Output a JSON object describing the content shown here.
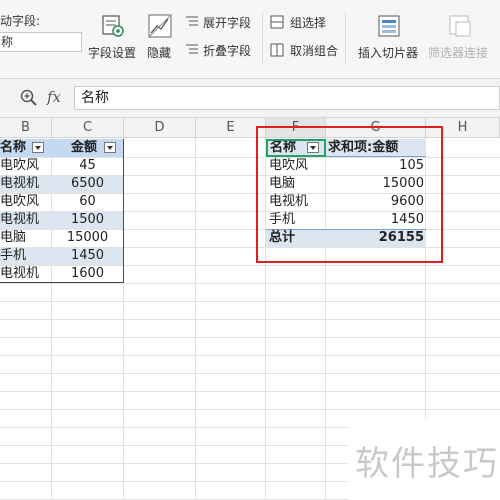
{
  "ribbon": {
    "active_field_label": "动字段:",
    "active_field_value": "称",
    "field_settings": "字段设置",
    "hide": "隐藏",
    "expand_field": "展开字段",
    "collapse_field": "折叠字段",
    "group_selection": "组选择",
    "ungroup": "取消组合",
    "insert_slicer": "插入切片器",
    "filter_connections": "筛选器连接"
  },
  "formula_bar": {
    "fx": "fx",
    "value": "名称"
  },
  "columns": [
    "B",
    "C",
    "D",
    "E",
    "F",
    "G",
    "H"
  ],
  "source_table": {
    "headers": [
      "名称",
      "金额"
    ],
    "rows": [
      [
        "电吹风",
        "45"
      ],
      [
        "电视机",
        "6500"
      ],
      [
        "电吹风",
        "60"
      ],
      [
        "电视机",
        "1500"
      ],
      [
        "电脑",
        "15000"
      ],
      [
        "手机",
        "1450"
      ],
      [
        "电视机",
        "1600"
      ]
    ]
  },
  "pivot_table": {
    "headers": [
      "名称",
      "求和项:金额"
    ],
    "rows": [
      [
        "电吹风",
        "105"
      ],
      [
        "电脑",
        "15000"
      ],
      [
        "电视机",
        "9600"
      ],
      [
        "手机",
        "1450"
      ]
    ],
    "total_label": "总计",
    "total_value": "26155"
  },
  "watermark": "软件技巧",
  "colors": {
    "header_blue": "#c5d9f1",
    "highlight_red": "#e02020",
    "selected_green": "#21a366"
  }
}
